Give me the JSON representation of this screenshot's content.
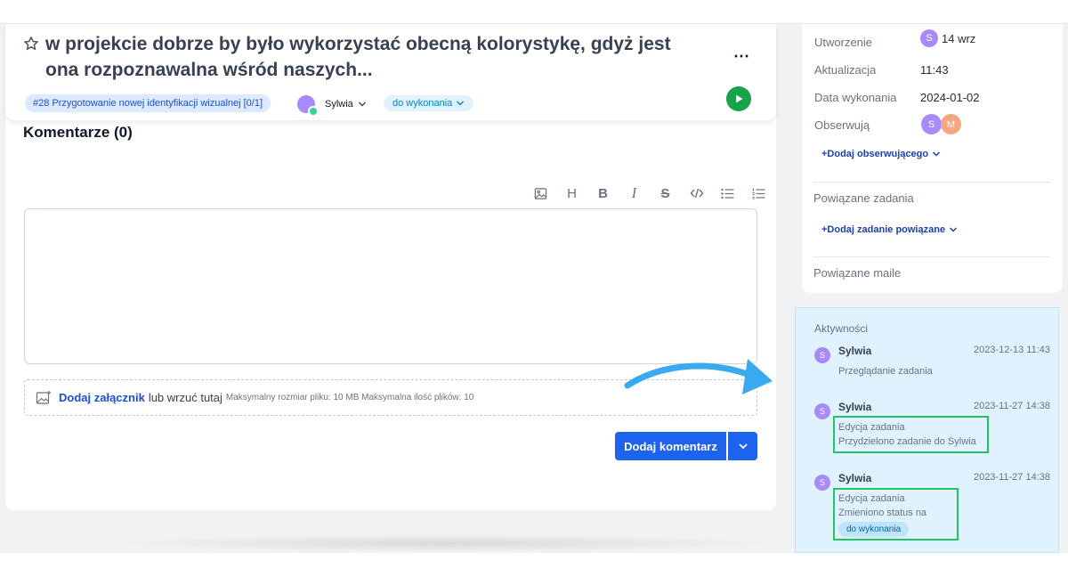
{
  "task": {
    "title": "w projekcie dobrze by było wykorzystać obecną kolorystykę, gdyż jest ona rozpoznawalna wśród naszych...",
    "parent_chip": "#28 Przygotowanie nowej identyfikacji wizualnej [0/1]",
    "assignee": "Sylwia",
    "status": "do wykonania"
  },
  "comments": {
    "heading": "Komentarze (0)",
    "toolbar": [
      "image-icon",
      "heading-icon",
      "bold-icon",
      "italic-icon",
      "strikethrough-icon",
      "code-icon",
      "bullet-list-icon",
      "numbered-list-icon"
    ],
    "toolbar_glyphs": {
      "heading": "H",
      "bold": "B",
      "italic": "I",
      "strike": "S"
    },
    "attach_link": "Dodaj załącznik",
    "attach_text": "lub wrzuć tutaj",
    "attach_meta": "Maksymalny rozmiar pliku: 10 MB Maksymalna ilość plików: 10",
    "submit_label": "Dodaj komentarz"
  },
  "meta": {
    "created_label": "Utworzenie",
    "created_value": "14 wrz",
    "created_avatar": "S",
    "updated_label": "Aktualizacja",
    "updated_value": "11:43",
    "due_label": "Data wykonania",
    "due_value": "2024-01-02",
    "watchers_label": "Obserwują",
    "watchers": [
      "S",
      "M"
    ],
    "add_watcher": "+Dodaj obserwującego",
    "related_tasks_label": "Powiązane zadania",
    "add_related_task": "+Dodaj zadanie powiązane",
    "related_mails_label": "Powiązane maile"
  },
  "activities": {
    "heading": "Aktywności",
    "items": [
      {
        "avatar": "S",
        "user": "Sylwia",
        "date": "2023-12-13 11:43",
        "lines": [
          "Przeglądanie zadania"
        ]
      },
      {
        "avatar": "S",
        "user": "Sylwia",
        "date": "2023-11-27 14:38",
        "lines": [
          "Edycja zadania",
          "Przydzielono zadanie do Sylwia"
        ]
      },
      {
        "avatar": "S",
        "user": "Sylwia",
        "date": "2023-11-27 14:38",
        "lines": [
          "Edycja zadania",
          "Zmieniono status na"
        ],
        "status": "do wykonania"
      }
    ]
  },
  "colors": {
    "primary": "#1d63ed",
    "play": "#16a34a",
    "highlight": "#22c55e",
    "activity_bg": "#e0f2fe",
    "arrow": "#3aaaf0"
  }
}
